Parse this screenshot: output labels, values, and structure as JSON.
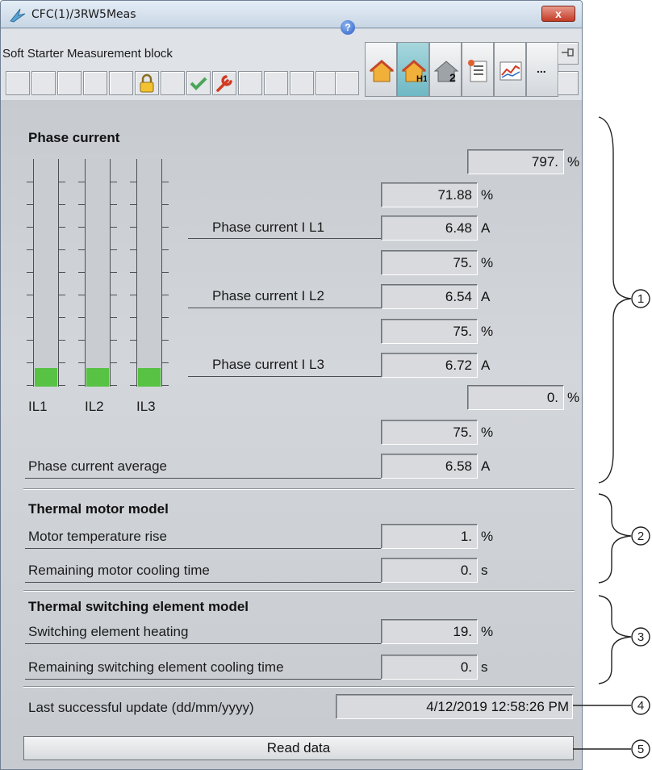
{
  "window": {
    "title": "CFC(1)/3RW5Meas",
    "close_label": "x"
  },
  "toolbar": {
    "block_title": "Soft Starter Measurement block",
    "help_label": "?",
    "more_label": "..."
  },
  "phase_current": {
    "heading": "Phase current",
    "top_percent": "797.",
    "l1": {
      "percent": "71.88",
      "label": "Phase current I L1",
      "value": "6.48"
    },
    "l2": {
      "percent": "75.",
      "label": "Phase current I L2",
      "value": "6.54"
    },
    "l3": {
      "percent": "75.",
      "label": "Phase current I L3",
      "value": "6.72"
    },
    "extra_percent": "0.",
    "avg_percent": "75.",
    "avg_label": "Phase current average",
    "avg_value": "6.58",
    "bars": [
      {
        "label": "IL1",
        "level_pct": 8
      },
      {
        "label": "IL2",
        "level_pct": 8
      },
      {
        "label": "IL3",
        "level_pct": 8
      }
    ]
  },
  "thermal_motor": {
    "heading": "Thermal motor model",
    "rise_label": "Motor temperature rise",
    "rise_value": "1.",
    "cool_label": "Remaining motor cooling time",
    "cool_value": "0."
  },
  "thermal_switch": {
    "heading": "Thermal switching element model",
    "heat_label": "Switching element heating",
    "heat_value": "19.",
    "cool_label": "Remaining switching element cooling time",
    "cool_value": "0."
  },
  "units": {
    "percent": "%",
    "amp": "A",
    "sec": "s"
  },
  "last_update": {
    "label": "Last successful update (dd/mm/yyyy)",
    "value": "4/12/2019  12:58:26 PM"
  },
  "read_button": "Read data",
  "callouts": [
    "1",
    "2",
    "3",
    "4",
    "5"
  ],
  "colors": {
    "bar_fill": "#57c244",
    "close": "#c43c26"
  }
}
